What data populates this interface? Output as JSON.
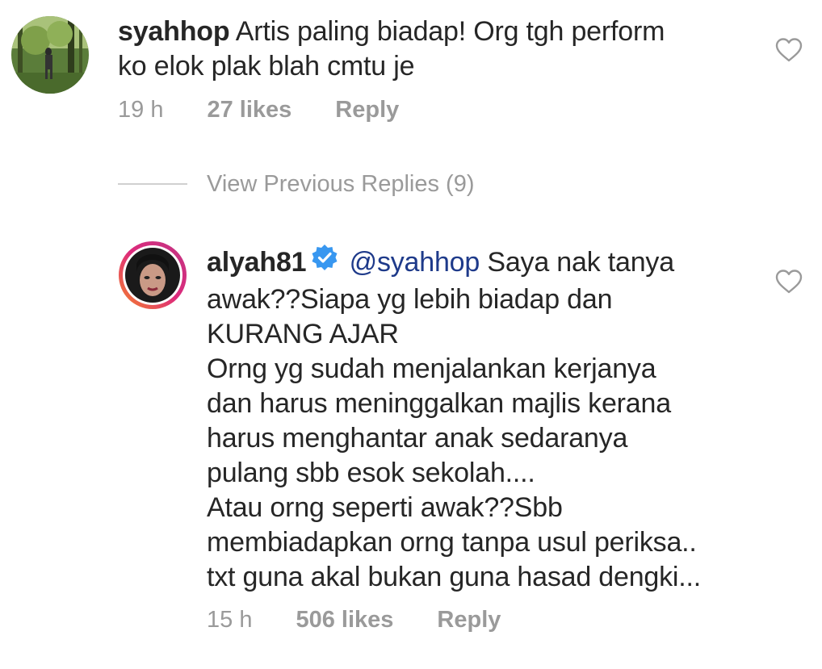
{
  "comment1": {
    "username": "syahhop",
    "text_line1": "Artis paling biadap! Org tgh perform",
    "text_line2": "ko elok plak blah cmtu je",
    "time": "19 h",
    "likes": "27 likes",
    "reply_label": "Reply"
  },
  "view_previous": "View Previous Replies (9)",
  "comment2": {
    "username": "alyah81",
    "mention": "@syahhop",
    "lines": [
      "Saya nak tanya",
      "awak??Siapa yg lebih biadap dan",
      "KURANG AJAR",
      "Orng yg sudah menjalankan kerjanya",
      "dan harus meninggalkan majlis kerana",
      "harus menghantar anak sedaranya",
      "pulang sbb esok sekolah....",
      "Atau orng seperti awak??Sbb",
      "membiadapkan orng tanpa usul periksa..",
      "txt guna akal bukan guna hasad dengki..."
    ],
    "time": "15 h",
    "likes": "506 likes",
    "reply_label": "Reply"
  },
  "icons": {
    "heart": "heart-outline-icon",
    "verified": "verified-badge-icon"
  },
  "colors": {
    "mention": "#1e3a8a",
    "verified": "#3897f0",
    "meta": "#9a9a9a",
    "story_ring_start": "#f58529",
    "story_ring_end": "#dd2a7b"
  }
}
